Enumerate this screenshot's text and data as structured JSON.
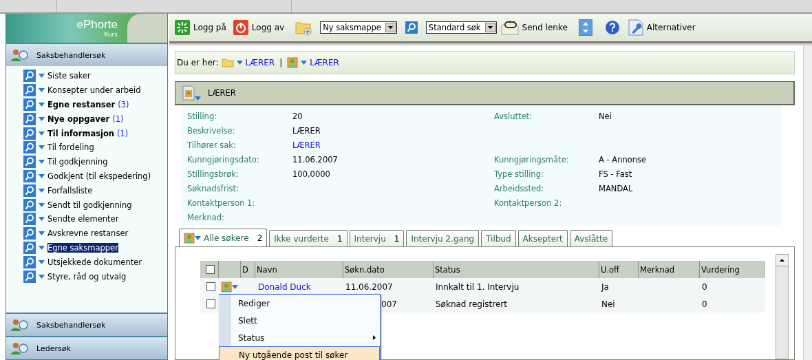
{
  "sidebar": {
    "logo": {
      "title": "ePhorte",
      "subtitle": "Kurs"
    },
    "header": "Saksbehandlersøk",
    "items": [
      {
        "label": "Siste saker",
        "bold": false,
        "selected": false
      },
      {
        "label": "Konsepter under arbeid",
        "bold": false,
        "selected": false
      },
      {
        "label": "Egne restanser",
        "count": "(3)",
        "bold": true,
        "selected": false
      },
      {
        "label": "Nye oppgaver",
        "count": "(1)",
        "bold": true,
        "selected": false
      },
      {
        "label": "Til informasjon",
        "count": "(1)",
        "bold": true,
        "selected": false
      },
      {
        "label": "Til fordeling",
        "bold": false,
        "selected": false
      },
      {
        "label": "Til godkjenning",
        "bold": false,
        "selected": false
      },
      {
        "label": "Godkjent (til ekspedering)",
        "bold": false,
        "selected": false
      },
      {
        "label": "Forfallsliste",
        "bold": false,
        "selected": false
      },
      {
        "label": "Sendt til godkjenning",
        "bold": false,
        "selected": false
      },
      {
        "label": "Sendte elementer",
        "bold": false,
        "selected": false
      },
      {
        "label": "Avskrevne restanser",
        "bold": false,
        "selected": false
      },
      {
        "label": "Egne saksmapper",
        "bold": false,
        "selected": true
      },
      {
        "label": "Utsjekkede dokumenter",
        "bold": false,
        "selected": false
      },
      {
        "label": "Styre, råd og utvalg",
        "bold": false,
        "selected": false
      }
    ],
    "sections": [
      "Saksbehandlersøk",
      "Ledersøk"
    ]
  },
  "toolbar": {
    "items": [
      {
        "kind": "button",
        "label": "Logg på"
      },
      {
        "kind": "button",
        "label": "Logg av"
      },
      {
        "kind": "icon"
      },
      {
        "kind": "select",
        "value": "Ny saksmappe"
      },
      {
        "kind": "icon"
      },
      {
        "kind": "select",
        "value": "Standard søk"
      },
      {
        "kind": "button",
        "label": "Send lenke"
      },
      {
        "kind": "icon"
      },
      {
        "kind": "icon"
      },
      {
        "kind": "button",
        "label": "Alternativer"
      }
    ]
  },
  "breadcrumb": {
    "label": "Du er her:",
    "separator": "|",
    "items": [
      {
        "text": "LÆRER"
      },
      {
        "text": "LÆRER"
      }
    ]
  },
  "record_header": {
    "title": "LÆRER"
  },
  "details": [
    {
      "left": {
        "label": "Stilling:",
        "value": "20"
      },
      "right": {
        "label": "Avsluttet:",
        "value": "Nei"
      }
    },
    {
      "left": {
        "label": "Beskrivelse:",
        "value": "LÆRER"
      }
    },
    {
      "left": {
        "label": "Tilhører sak:",
        "value": "LÆRER",
        "link": true
      }
    },
    {
      "left": {
        "label": "Kunngjøringsdato:",
        "value": "11.06.2007"
      },
      "right": {
        "label": "Kunngjøringsmåte:",
        "value": "A - Annonse"
      }
    },
    {
      "left": {
        "label": "Stillingsbrøk:",
        "value": "100,0000"
      },
      "right": {
        "label": "Type stilling:",
        "value": "FS - Fast"
      }
    },
    {
      "left": {
        "label": "Søknadsfrist:"
      },
      "right": {
        "label": "Arbeidssted:",
        "value": "MANDAL"
      }
    },
    {
      "left": {
        "label": "Kontaktperson 1:"
      },
      "right": {
        "label": "Kontaktperson 2:"
      }
    },
    {
      "left": {
        "label": "Merknad:"
      }
    }
  ],
  "tabs": [
    {
      "label": "Alle søkere",
      "count": "2",
      "icon": true,
      "selected": true
    },
    {
      "label": "Ikke vurderte",
      "count": "1",
      "icon": false,
      "selected": false
    },
    {
      "label": "Intervju",
      "count": "1",
      "icon": false,
      "selected": false
    },
    {
      "label": "Intervju 2.gang",
      "icon": false,
      "selected": false
    },
    {
      "label": "Tilbud",
      "icon": false,
      "selected": false
    },
    {
      "label": "Akseptert",
      "icon": false,
      "selected": false
    },
    {
      "label": "Avslåtte",
      "icon": false,
      "selected": false
    }
  ],
  "table": {
    "header_checked": false,
    "columns": [
      "D",
      "Navn",
      "Søkn.dato",
      "Status",
      "U.off",
      "Merknad",
      "Vurdering"
    ],
    "rows": [
      {
        "checked": false,
        "icon": true,
        "name": "Donald Duck",
        "date": "11.06.2007",
        "status": "Innkalt til 1. Intervju",
        "u_off": "Ja",
        "vurdering": "0",
        "partly_hidden": false
      },
      {
        "checked": false,
        "icon": false,
        "date": "007",
        "status": "Søknad registrert",
        "u_off": "Nei",
        "vurdering": "0",
        "partly_hidden": true
      }
    ]
  },
  "context_menu": {
    "items": [
      {
        "label": "Rediger",
        "submenu": false,
        "highlighted": false
      },
      {
        "label": "Slett",
        "submenu": false,
        "highlighted": false
      },
      {
        "label": "Status",
        "submenu": true,
        "highlighted": false
      },
      {
        "label": "Ny utgående post til søker",
        "submenu": false,
        "highlighted": true
      }
    ]
  }
}
